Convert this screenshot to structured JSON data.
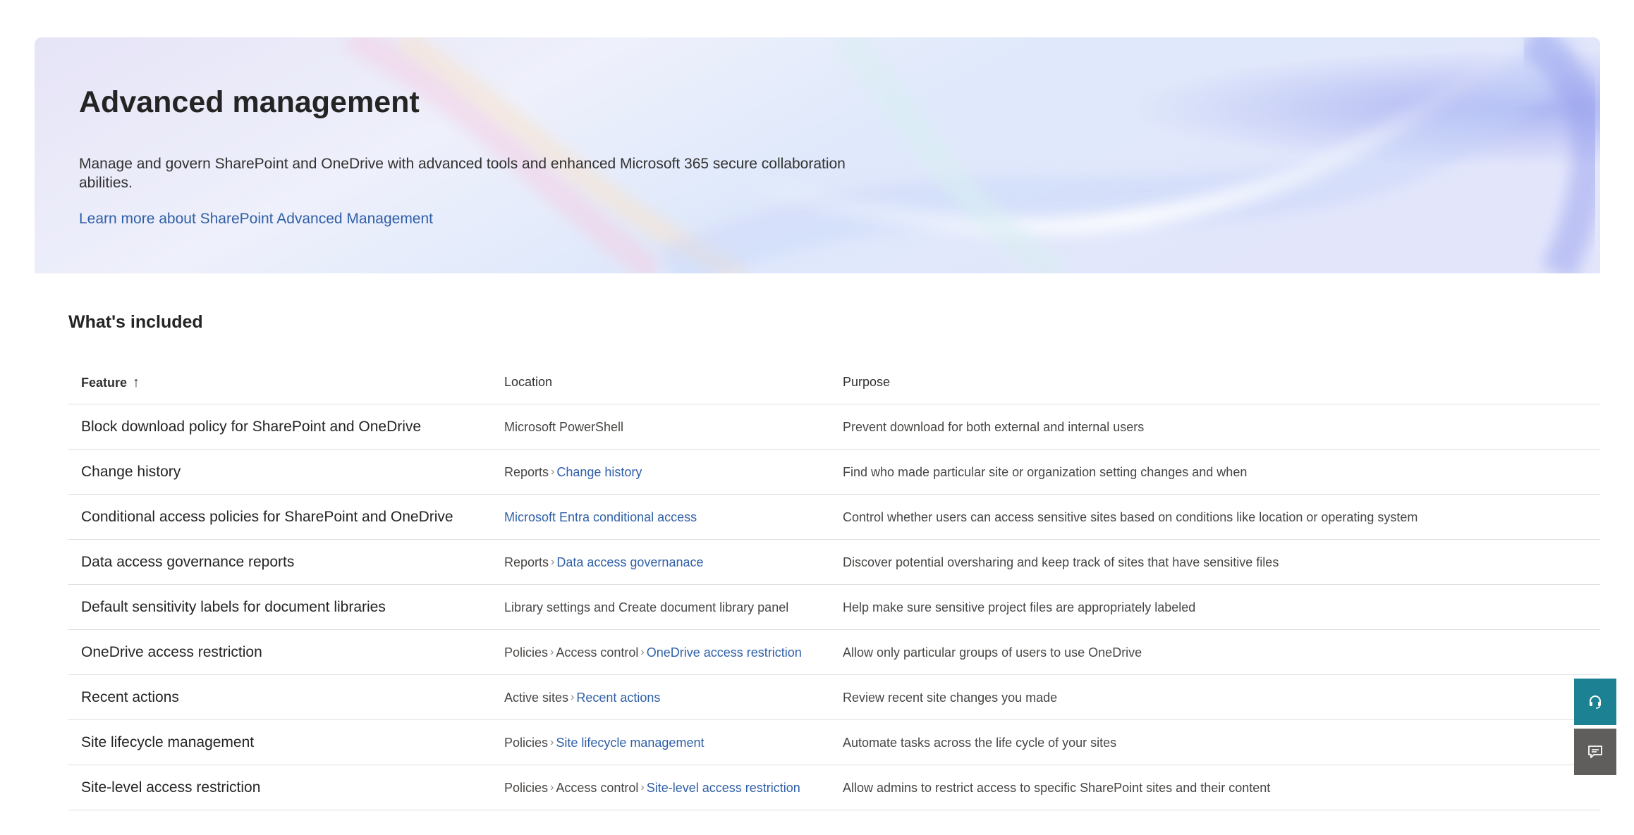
{
  "hero": {
    "title": "Advanced management",
    "description": "Manage and govern SharePoint and OneDrive with advanced tools and enhanced Microsoft 365 secure collaboration abilities.",
    "learn_more_link": "Learn more about SharePoint Advanced Management"
  },
  "section": {
    "title": "What's included"
  },
  "table": {
    "headers": {
      "feature": "Feature",
      "feature_sort": "↑",
      "location": "Location",
      "purpose": "Purpose"
    },
    "rows": [
      {
        "feature": "Block download policy for SharePoint and OneDrive",
        "location": [
          {
            "text": "Microsoft PowerShell",
            "link": false
          }
        ],
        "purpose": "Prevent download for both external and internal users"
      },
      {
        "feature": "Change history",
        "location": [
          {
            "text": "Reports",
            "link": false
          },
          {
            "text": "Change history",
            "link": true
          }
        ],
        "purpose": "Find who made particular site or organization setting changes and when"
      },
      {
        "feature": "Conditional access policies for SharePoint and OneDrive",
        "location": [
          {
            "text": "Microsoft Entra conditional access",
            "link": true
          }
        ],
        "purpose": "Control whether users can access sensitive sites based on conditions like location or operating system"
      },
      {
        "feature": "Data access governance reports",
        "location": [
          {
            "text": "Reports",
            "link": false
          },
          {
            "text": "Data access governanace",
            "link": true
          }
        ],
        "purpose": "Discover potential oversharing and keep track of sites that have sensitive files"
      },
      {
        "feature": "Default sensitivity labels for document libraries",
        "location": [
          {
            "text": "Library settings and Create document library panel",
            "link": false
          }
        ],
        "purpose": "Help make sure sensitive project files are appropriately labeled"
      },
      {
        "feature": "OneDrive access restriction",
        "location": [
          {
            "text": "Policies",
            "link": false
          },
          {
            "text": "Access control",
            "link": false
          },
          {
            "text": "OneDrive access restriction",
            "link": true
          }
        ],
        "purpose": "Allow only particular groups of users to use OneDrive"
      },
      {
        "feature": "Recent actions",
        "location": [
          {
            "text": "Active sites",
            "link": false
          },
          {
            "text": "Recent actions",
            "link": true
          }
        ],
        "purpose": "Review recent site changes you made"
      },
      {
        "feature": "Site lifecycle management",
        "location": [
          {
            "text": "Policies",
            "link": false
          },
          {
            "text": "Site lifecycle management",
            "link": true
          }
        ],
        "purpose": "Automate tasks across the life cycle of your sites"
      },
      {
        "feature": "Site-level access restriction",
        "location": [
          {
            "text": "Policies",
            "link": false
          },
          {
            "text": "Access control",
            "link": false
          },
          {
            "text": "Site-level access restriction",
            "link": true
          }
        ],
        "purpose": "Allow admins to restrict access to specific SharePoint sites and their content"
      }
    ]
  },
  "floating_buttons": [
    {
      "name": "support",
      "icon": "headset-icon",
      "color": "#1b8193"
    },
    {
      "name": "feedback",
      "icon": "feedback-icon",
      "color": "#605e5c"
    }
  ],
  "colors": {
    "link": "#2f5fa7",
    "text": "#323130",
    "divider": "#e1dfdd"
  }
}
